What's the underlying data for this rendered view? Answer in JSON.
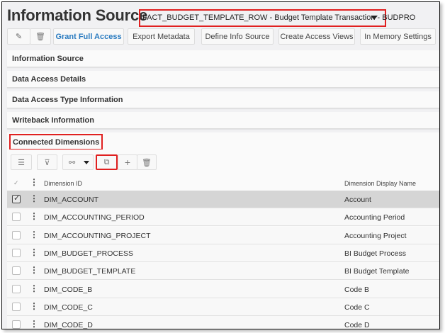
{
  "header": {
    "title": "Information Source",
    "source_selector": "FACT_BUDGET_TEMPLATE_ROW - Budget Template Transaction - BUDPRO"
  },
  "toolbar": {
    "grant": "Grant Full Access",
    "export": "Export Metadata",
    "define": "Define Info Source",
    "create": "Create Access Views",
    "memory": "In Memory Settings"
  },
  "sections": [
    "Information Source",
    "Data Access Details",
    "Data Access Type Information",
    "Writeback Information"
  ],
  "connected": {
    "title": "Connected Dimensions",
    "columns": {
      "check": "✓",
      "id": "Dimension ID",
      "name": "Dimension Display Name"
    },
    "rows": [
      {
        "id": "DIM_ACCOUNT",
        "name": "Account",
        "selected": true
      },
      {
        "id": "DIM_ACCOUNTING_PERIOD",
        "name": "Accounting Period"
      },
      {
        "id": "DIM_ACCOUNTING_PROJECT",
        "name": "Accounting Project"
      },
      {
        "id": "DIM_BUDGET_PROCESS",
        "name": "BI Budget Process"
      },
      {
        "id": "DIM_BUDGET_TEMPLATE",
        "name": "BI Budget Template"
      },
      {
        "id": "DIM_CODE_B",
        "name": "Code B"
      },
      {
        "id": "DIM_CODE_C",
        "name": "Code C"
      },
      {
        "id": "DIM_CODE_D",
        "name": "Code D"
      }
    ]
  }
}
